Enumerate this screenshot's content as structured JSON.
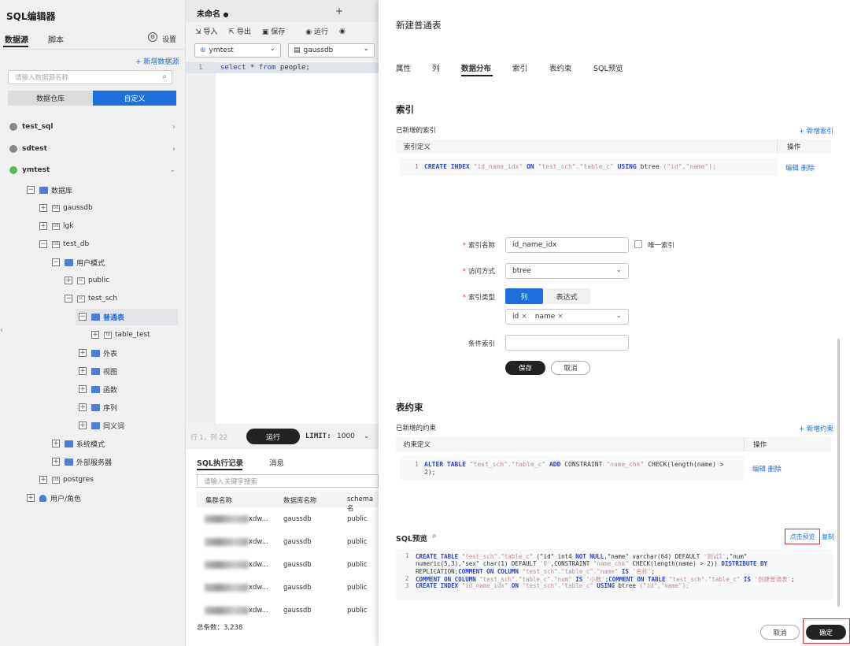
{
  "app": {
    "title": "SQL编辑器",
    "tabs": [
      "数据源",
      "脚本"
    ],
    "settings_label": "设置"
  },
  "datasource": {
    "add_label": "+ 新增数据源",
    "search_placeholder": "请输入数据源名称",
    "toggle": [
      "数据仓库",
      "自定义"
    ]
  },
  "tree": {
    "sources": [
      "test_sql",
      "sdtest",
      "ymtest"
    ],
    "db_folder": "数据库",
    "dbs": [
      "gaussdb",
      "lgk",
      "test_db"
    ],
    "user_schema": "用户模式",
    "schemas": [
      "public",
      "test_sch"
    ],
    "normal_table": "普通表",
    "table": "table_test",
    "folders": [
      "外表",
      "视图",
      "函数",
      "序列",
      "同义词"
    ],
    "system_schema": "系统模式",
    "external_server": "外部服务器",
    "postgres": "postgres",
    "user_role": "用户/角色",
    "db_icon_text": "DB",
    "sc_icon_text": "SC",
    "tb_icon_text": "TB"
  },
  "editor": {
    "tab_title": "未命名",
    "add_tab": "+",
    "toolbar": [
      "导入",
      "导出",
      "保存",
      "运行"
    ],
    "ds_select": "ymtest",
    "db_select": "gaussdb",
    "line_no": "1",
    "sql_select": "select",
    "sql_star": "*",
    "sql_from": "from",
    "sql_table": "people;",
    "cursor": "行 1，列 22",
    "run_label": "运行",
    "limit_label": "LIMIT:",
    "limit_value": "1000",
    "result_tabs": [
      "SQL执行记录",
      "消息"
    ],
    "search_placeholder": "请输入关键字搜索",
    "columns": [
      "集群名称",
      "数据库名称",
      "schema名"
    ],
    "rows": [
      {
        "c1": "xdw...",
        "c2": "gaussdb",
        "c3": "public"
      },
      {
        "c1": "xdw...",
        "c2": "gaussdb",
        "c3": "public"
      },
      {
        "c1": "xdw...",
        "c2": "gaussdb",
        "c3": "public"
      },
      {
        "c1": "xdw...",
        "c2": "gaussdb",
        "c3": "public"
      },
      {
        "c1": "xdw...",
        "c2": "gaussdb",
        "c3": "public"
      }
    ],
    "total": "总条数：3,238"
  },
  "modal": {
    "title": "新建普通表",
    "tabs": [
      "属性",
      "列",
      "数据分布",
      "索引",
      "表约束",
      "SQL预览"
    ],
    "active_tab": "数据分布",
    "index_section": "索引",
    "added_indexes": "已新增的索引",
    "add_index": "+ 新增索引",
    "index_col_def": "索引定义",
    "col_ops": "操作",
    "index_row": {
      "num": "1",
      "parts": [
        {
          "t": "CREATE INDEX ",
          "k": "kw"
        },
        {
          "t": "\"id_name_idx\" ",
          "k": "str"
        },
        {
          "t": "ON ",
          "k": "kw"
        },
        {
          "t": "\"test_sch\".\"table_c\" ",
          "k": "str"
        },
        {
          "t": "USING ",
          "k": "kw"
        },
        {
          "t": "btree ",
          "k": "plain"
        },
        {
          "t": "(\"id\",\"name\");",
          "k": "str"
        }
      ]
    },
    "edit": "编辑",
    "delete": "删除",
    "form": {
      "name_label": "索引名称",
      "name_value": "id_name_idx",
      "unique_label": "唯一索引",
      "access_label": "访问方式",
      "access_value": "btree",
      "type_label": "索引类型",
      "type_options": [
        "列",
        "表达式"
      ],
      "columns": [
        "id",
        "name"
      ],
      "cond_label": "条件索引",
      "save": "保存",
      "cancel": "取消"
    },
    "constraint_section": "表约束",
    "added_constraints": "已新增的约束",
    "add_constraint": "+ 新增约束",
    "constraint_col_def": "约束定义",
    "constraint_row": {
      "num": "1",
      "line1": [
        {
          "t": "ALTER TABLE ",
          "k": "kw"
        },
        {
          "t": "\"test_sch\".\"table_c\" ",
          "k": "str"
        },
        {
          "t": "ADD ",
          "k": "kw"
        },
        {
          "t": "CONSTRAINT ",
          "k": "plain"
        },
        {
          "t": "\"name_chk\" ",
          "k": "str"
        },
        {
          "t": "CHECK(length(name) >",
          "k": "plain"
        }
      ],
      "line2": [
        {
          "t": "2);",
          "k": "plain"
        }
      ]
    },
    "sql_preview": "SQL预览",
    "click_preview": "点击预览",
    "copy": "复制",
    "preview_lines": [
      {
        "num": "1",
        "parts": [
          {
            "t": "CREATE TABLE ",
            "k": "kw"
          },
          {
            "t": "\"test_sch\".\"table_c\" ",
            "k": "str"
          },
          {
            "t": "(\"id\" int4 ",
            "k": "plain"
          },
          {
            "t": "NOT NULL",
            "k": "kw"
          },
          {
            "t": ",\"name\" varchar(64) DEFAULT ",
            "k": "plain"
          },
          {
            "t": "'测试1'",
            "k": "str"
          },
          {
            "t": ",\"num\"",
            "k": "plain"
          }
        ]
      },
      {
        "num": "",
        "parts": [
          {
            "t": "numeric(5,3),\"sex\" char(1) DEFAULT ",
            "k": "plain"
          },
          {
            "t": "'0'",
            "k": "str"
          },
          {
            "t": ",CONSTRAINT ",
            "k": "plain"
          },
          {
            "t": "\"name_chk\" ",
            "k": "str"
          },
          {
            "t": "CHECK(length(name) > 2)) ",
            "k": "plain"
          },
          {
            "t": "DISTRIBUTE BY",
            "k": "kw"
          }
        ]
      },
      {
        "num": "",
        "parts": [
          {
            "t": "REPLICATION;",
            "k": "plain"
          },
          {
            "t": "COMMENT ON COLUMN ",
            "k": "kw"
          },
          {
            "t": "\"test_sch\".\"table_c\".\"name\" ",
            "k": "str"
          },
          {
            "t": "IS ",
            "k": "kw"
          },
          {
            "t": "'名称'",
            "k": "str"
          },
          {
            "t": ";",
            "k": "plain"
          }
        ]
      },
      {
        "num": "2",
        "parts": [
          {
            "t": "COMMENT ON COLUMN ",
            "k": "kw"
          },
          {
            "t": "\"test_sch\".\"table_c\".\"num\" ",
            "k": "str"
          },
          {
            "t": "IS ",
            "k": "kw"
          },
          {
            "t": "'小数'",
            "k": "str"
          },
          {
            "t": ";",
            "k": "plain"
          },
          {
            "t": "COMMENT ON TABLE ",
            "k": "kw"
          },
          {
            "t": "\"test_sch\".\"table_c\" ",
            "k": "str"
          },
          {
            "t": "IS ",
            "k": "kw"
          },
          {
            "t": "'创建普通表'",
            "k": "str"
          },
          {
            "t": ";",
            "k": "plain"
          }
        ]
      },
      {
        "num": "3",
        "parts": [
          {
            "t": "CREATE INDEX ",
            "k": "kw"
          },
          {
            "t": "\"id_name_idx\" ",
            "k": "str"
          },
          {
            "t": "ON ",
            "k": "kw"
          },
          {
            "t": "\"test_sch\".\"table_c\" ",
            "k": "str"
          },
          {
            "t": "USING ",
            "k": "kw"
          },
          {
            "t": "btree ",
            "k": "plain"
          },
          {
            "t": "(\"id\",\"name\");",
            "k": "str"
          }
        ]
      }
    ],
    "footer_cancel": "取消",
    "footer_ok": "确定"
  },
  "colors": {
    "accent": "#1e6fde",
    "dark": "#222222",
    "highlight_border": "#e03030"
  }
}
